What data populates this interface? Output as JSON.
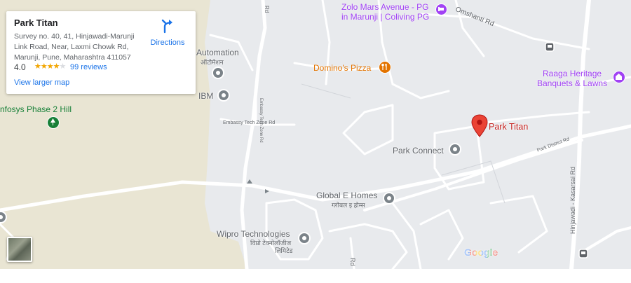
{
  "card": {
    "title": "Park Titan",
    "address": "Survey no. 40, 41, Hinjawadi-Marunji Link Road, Near, Laxmi Chowk Rd, Marunji, Pune, Maharashtra 411057",
    "rating": "4.0",
    "stars": 4,
    "reviews": "99 reviews",
    "directions": "Directions",
    "view_larger": "View larger map"
  },
  "places": {
    "zolo_line1": "Zolo Mars Avenue - PG",
    "zolo_line2": "in Marunji | Coliving PG",
    "automation": "Automation",
    "automation_sub": "ऑटोमेशन",
    "dominos": "Domino's Pizza",
    "raaga_line1": "Raaga Heritage",
    "raaga_line2": "Banquets & Lawns",
    "ibm": "IBM",
    "infosys": "nfosys Phase 2 Hill",
    "park_titan": "Park Titan",
    "park_connect": "Park Connect",
    "global_e_homes": "Global E Homes",
    "global_e_homes_sub": "ग्लोबल इ होम्स",
    "wipro": "Wipro Technologies",
    "wipro_sub1": "विप्रो टेक्नोलॉजीज",
    "wipro_sub2": "लिमिटेड"
  },
  "roads": {
    "omshanti": "Omshanti Rd",
    "embassy": "Embassy Tech Zone Rd",
    "park_district": "Park District Rd",
    "hinjawadi_kasarsai": "Hinjawadi - Kasarsai Rd",
    "rd_small": "Rd",
    "rd_bottom": "Rd"
  },
  "branding": {
    "google": "Google"
  },
  "colors": {
    "map_bg": "#e8eaed",
    "park": "#e9e5d3",
    "road": "#ffffff",
    "pin_red": "#ea4335",
    "link_blue": "#1a73e8",
    "poi_purple": "#a142f4",
    "food_orange": "#e37400",
    "park_green": "#188038"
  }
}
